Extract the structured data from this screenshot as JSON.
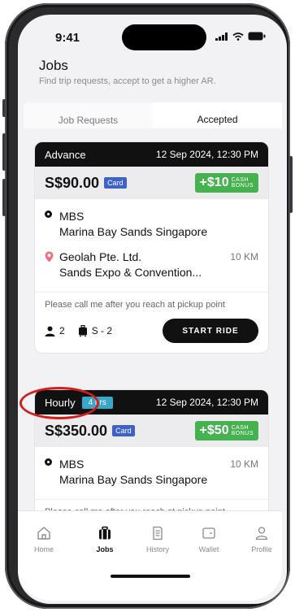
{
  "status": {
    "time": "9:41"
  },
  "header": {
    "title": "Jobs",
    "subtitle": "Find trip requests, accept to get a higher AR."
  },
  "tabs": [
    {
      "label": "Job Requests"
    },
    {
      "label": "Accepted"
    }
  ],
  "jobs": [
    {
      "type": "Advance",
      "datetime": "12 Sep 2024, 12:30 PM",
      "fare": "S$90.00",
      "payment": "Card",
      "bonus_amount": "+$10",
      "bonus_line1": "CASH",
      "bonus_line2": "BONUS",
      "pickup_name": "MBS",
      "pickup_detail": "Marina Bay Sands Singapore",
      "dropoff_name": "Geolah Pte. Ltd.",
      "dropoff_detail": "Sands Expo & Convention...",
      "distance": "10 KM",
      "note": "Please call me after you reach at pickup point",
      "passengers": "2",
      "luggage": "S - 2",
      "action": "START RIDE"
    },
    {
      "type": "Hourly",
      "duration": "4 hrs",
      "datetime": "12 Sep 2024, 12:30 PM",
      "fare": "S$350.00",
      "payment": "Card",
      "bonus_amount": "+$50",
      "bonus_line1": "CASH",
      "bonus_line2": "BONUS",
      "pickup_name": "MBS",
      "pickup_detail": "Marina Bay Sands Singapore",
      "distance": "10 KM",
      "note": "Please call me after you reach at pickup point"
    }
  ],
  "nav": [
    {
      "label": "Home",
      "icon": "home-icon"
    },
    {
      "label": "Jobs",
      "icon": "briefcase-icon"
    },
    {
      "label": "History",
      "icon": "history-icon"
    },
    {
      "label": "Wallet",
      "icon": "wallet-icon"
    },
    {
      "label": "Profile",
      "icon": "profile-icon"
    }
  ],
  "colors": {
    "accent": "#4a62b8",
    "bonus": "#45b24f",
    "card_badge": "#3d63c9",
    "hours_badge": "#3aa7c9",
    "pin": "#f06f7e",
    "annotation": "#d31d1d"
  }
}
